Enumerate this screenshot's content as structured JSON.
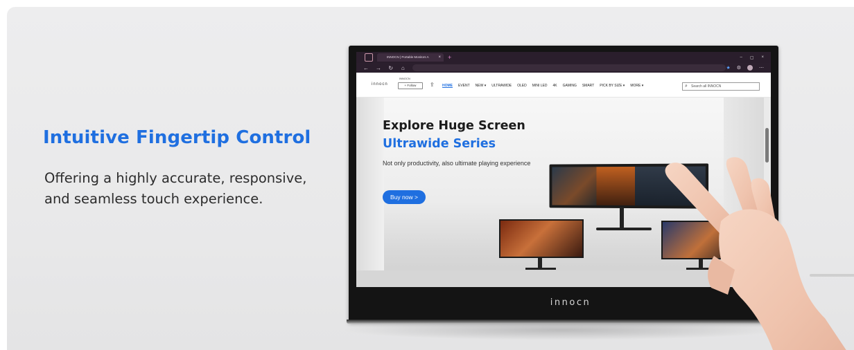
{
  "promo": {
    "headline": "Intuitive Fingertip Control",
    "subcopy": "Offering a highly accurate, responsive, and seamless touch experience."
  },
  "monitor": {
    "bezel_brand": "innocn"
  },
  "browser": {
    "tab_title": "INNOCN | Portable Monitors A",
    "tab_close": "×",
    "new_tab": "+",
    "window_controls": [
      "–",
      "▢",
      "×"
    ]
  },
  "site": {
    "logo": "innocn",
    "logo_small": "INNOCN",
    "follow_label": "+ Follow",
    "nav": [
      "HOME",
      "EVENT",
      "NEW ▾",
      "ULTRAWIDE",
      "OLED",
      "MINI LED",
      "4K",
      "GAMING",
      "SMART",
      "PICK BY SIZE ▾",
      "MORE ▾"
    ],
    "search_placeholder": "Search all INNOCN"
  },
  "hero": {
    "title": "Explore Huge Screen",
    "subtitle": "Ultrawide Series",
    "description": "Not only productivity, also ultimate playing experience",
    "cta": "Buy now >"
  },
  "colors": {
    "accent": "#1f6fe0",
    "chrome": "#2a1e2c",
    "background": "#ebebec"
  }
}
